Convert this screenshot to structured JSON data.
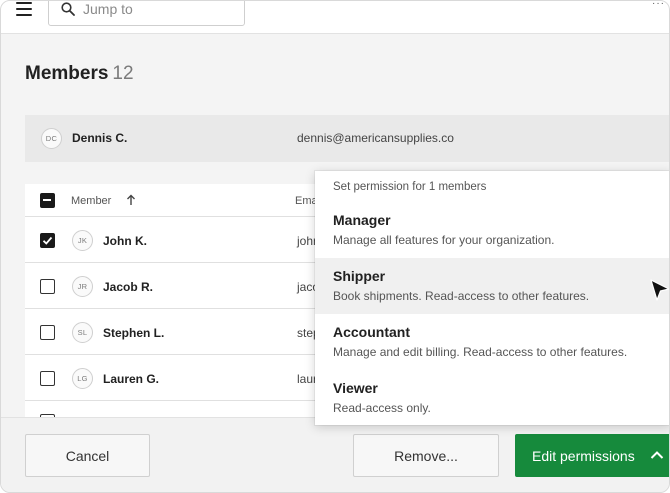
{
  "search": {
    "placeholder": "Jump to"
  },
  "page": {
    "title": "Members",
    "count": "12"
  },
  "banner": {
    "initials": "DC",
    "name": "Dennis C.",
    "email": "dennis@americansupplies.co"
  },
  "table": {
    "columns": {
      "member": "Member",
      "email": "Ema"
    },
    "rows": [
      {
        "initials": "JK",
        "name": "John K.",
        "email": "johr",
        "checked": true
      },
      {
        "initials": "JR",
        "name": "Jacob R.",
        "email": "jaco",
        "checked": false
      },
      {
        "initials": "SL",
        "name": "Stephen L.",
        "email": "step",
        "checked": false
      },
      {
        "initials": "LG",
        "name": "Lauren G.",
        "email": "laur",
        "checked": false
      }
    ]
  },
  "dropdown": {
    "header": "Set permission for 1 members",
    "items": [
      {
        "title": "Manager",
        "desc": "Manage all features for your organization."
      },
      {
        "title": "Shipper",
        "desc": "Book shipments. Read-access to other features."
      },
      {
        "title": "Accountant",
        "desc": "Manage and edit billing. Read-access to other features."
      },
      {
        "title": "Viewer",
        "desc": "Read-access only."
      }
    ],
    "active_item": "Shipper"
  },
  "footer": {
    "cancel_label": "Cancel",
    "remove_label": "Remove...",
    "edit_label": "Edit permissions"
  },
  "colors": {
    "accent": "#168a3c",
    "highlight": "#f0f0f0"
  },
  "icons": [
    "menu-icon",
    "search-icon",
    "sort-up-icon",
    "check-icon",
    "chevron-up-icon",
    "cursor-icon"
  ]
}
